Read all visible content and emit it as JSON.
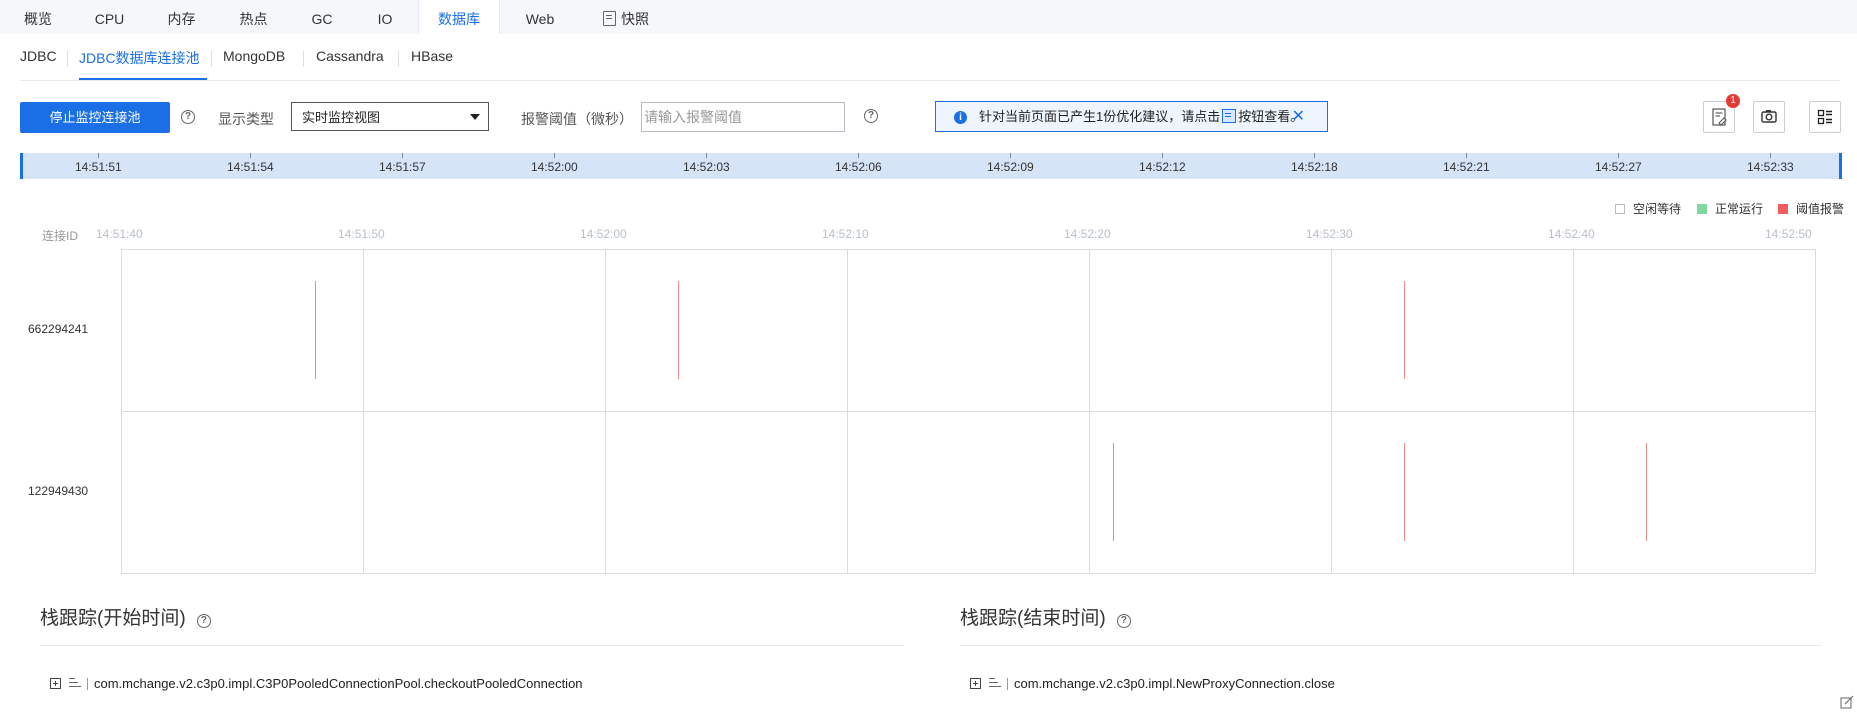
{
  "top_tabs": [
    "概览",
    "CPU",
    "内存",
    "热点",
    "GC",
    "IO",
    "数据库",
    "Web",
    "快照"
  ],
  "active_top_tab": "数据库",
  "sub_tabs": [
    "JDBC",
    "JDBC数据库连接池",
    "MongoDB",
    "Cassandra",
    "HBase"
  ],
  "active_sub_tab": "JDBC数据库连接池",
  "toolbar": {
    "stop_button": "停止监控连接池",
    "display_type_label": "显示类型",
    "display_type_value": "实时监控视图",
    "threshold_label": "报警阈值（微秒）",
    "threshold_placeholder": "请输入报警阈值",
    "notice_text_before": "针对当前页面已产生1份优化建议，请点击",
    "notice_text_after": "按钮查看。",
    "badge_count": "1"
  },
  "timeline": {
    "labels": [
      "14:51:51",
      "14:51:54",
      "14:51:57",
      "14:52:00",
      "14:52:03",
      "14:52:06",
      "14:52:09",
      "14:52:12",
      "14:52:18",
      "14:52:21",
      "14:52:27",
      "14:52:33"
    ]
  },
  "legend": [
    {
      "label": "空闲等待",
      "color": "#ffffff"
    },
    {
      "label": "正常运行",
      "color": "#7fd8a0"
    },
    {
      "label": "阈值报警",
      "color": "#f25c5c"
    }
  ],
  "chart_data": {
    "type": "timeline",
    "ylabel": "连接ID",
    "x_ticks": [
      "14:51:40",
      "14:51:50",
      "14:52:00",
      "14:52:10",
      "14:52:20",
      "14:52:30",
      "14:52:40",
      "14:52:50"
    ],
    "xlim": [
      "14:51:40",
      "14:52:50"
    ],
    "rows": [
      "662294241",
      "122949430"
    ],
    "series": [
      {
        "name": "阈值报警",
        "color": "#f08a8a",
        "events": [
          {
            "row": "662294241",
            "x": "14:51:48"
          },
          {
            "row": "662294241",
            "x": "14:52:03"
          },
          {
            "row": "662294241",
            "x": "14:52:33"
          },
          {
            "row": "122949430",
            "x": "14:52:21"
          },
          {
            "row": "122949430",
            "x": "14:52:33"
          },
          {
            "row": "122949430",
            "x": "14:52:43"
          }
        ]
      }
    ]
  },
  "stack": {
    "start_title": "栈跟踪(开始时间)",
    "end_title": "栈跟踪(结束时间)",
    "start_entry": "com.mchange.v2.c3p0.impl.C3P0PooledConnectionPool.checkoutPooledConnection",
    "end_entry": "com.mchange.v2.c3p0.impl.NewProxyConnection.close"
  }
}
